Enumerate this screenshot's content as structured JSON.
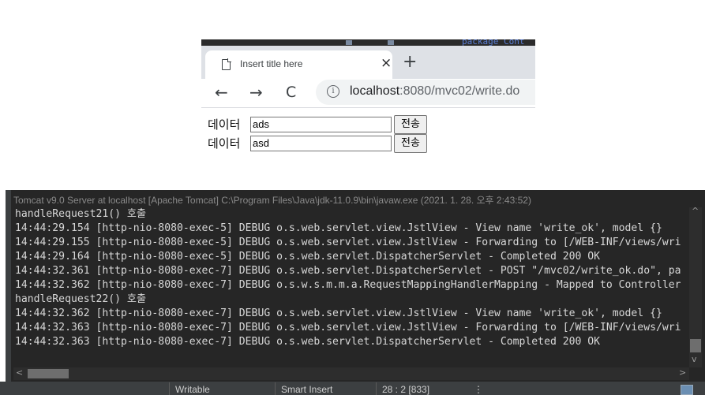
{
  "browser": {
    "background_code": "package Cont",
    "tab": {
      "title": "Insert title here",
      "close_glyph": "×"
    },
    "new_tab_glyph": "+",
    "nav": {
      "back_glyph": "←",
      "forward_glyph": "→",
      "reload_glyph": "C"
    },
    "address": {
      "host": "localhost",
      "rest": ":8080/mvc02/write.do",
      "info_glyph": "i"
    }
  },
  "form": {
    "rows": [
      {
        "label": "데이터",
        "value": "ads",
        "button": "전송"
      },
      {
        "label": "데이터",
        "value": "asd",
        "button": "전송"
      }
    ]
  },
  "console": {
    "header": "Tomcat v9.0 Server at localhost [Apache Tomcat] C:\\Program Files\\Java\\jdk-11.0.9\\bin\\javaw.exe  (2021. 1. 28. 오후 2:43:52)",
    "lines": [
      "handleRequest21() 호출",
      "14:44:29.154 [http-nio-8080-exec-5] DEBUG o.s.web.servlet.view.JstlView - View name 'write_ok', model {}",
      "14:44:29.155 [http-nio-8080-exec-5] DEBUG o.s.web.servlet.view.JstlView - Forwarding to [/WEB-INF/views/wri",
      "14:44:29.164 [http-nio-8080-exec-5] DEBUG o.s.web.servlet.DispatcherServlet - Completed 200 OK",
      "14:44:32.361 [http-nio-8080-exec-7] DEBUG o.s.web.servlet.DispatcherServlet - POST \"/mvc02/write_ok.do\", pa",
      "14:44:32.362 [http-nio-8080-exec-7] DEBUG o.s.w.s.m.m.a.RequestMappingHandlerMapping - Mapped to Controller",
      "handleRequest22() 호출",
      "14:44:32.362 [http-nio-8080-exec-7] DEBUG o.s.web.servlet.view.JstlView - View name 'write_ok', model {}",
      "14:44:32.363 [http-nio-8080-exec-7] DEBUG o.s.web.servlet.view.JstlView - Forwarding to [/WEB-INF/views/wri",
      "14:44:32.363 [http-nio-8080-exec-7] DEBUG o.s.web.servlet.DispatcherServlet - Completed 200 OK"
    ],
    "scroll": {
      "up_glyph": "^",
      "down_glyph": "v",
      "left_glyph": "<",
      "right_glyph": ">"
    }
  },
  "statusbar": {
    "writable": "Writable",
    "insert_mode": "Smart Insert",
    "position": "28 : 2 [833]",
    "menu_glyph": "⋮"
  }
}
